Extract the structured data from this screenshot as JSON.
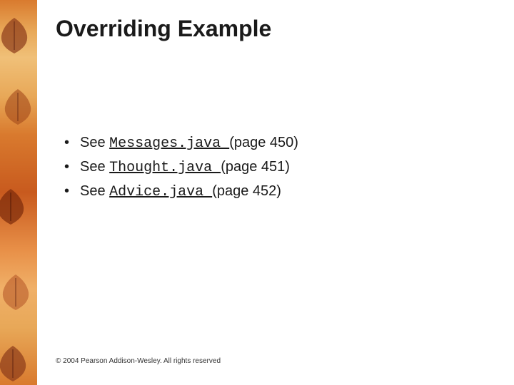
{
  "title": "Overriding Example",
  "bullets": [
    {
      "prefix": "See ",
      "filename": "Messages.java ",
      "pageref": "(page 450)"
    },
    {
      "prefix": "See ",
      "filename": "Thought.java ",
      "pageref": "(page 451)"
    },
    {
      "prefix": "See ",
      "filename": "Advice.java ",
      "pageref": "(page 452)"
    }
  ],
  "footer": "© 2004 Pearson Addison-Wesley. All rights reserved"
}
